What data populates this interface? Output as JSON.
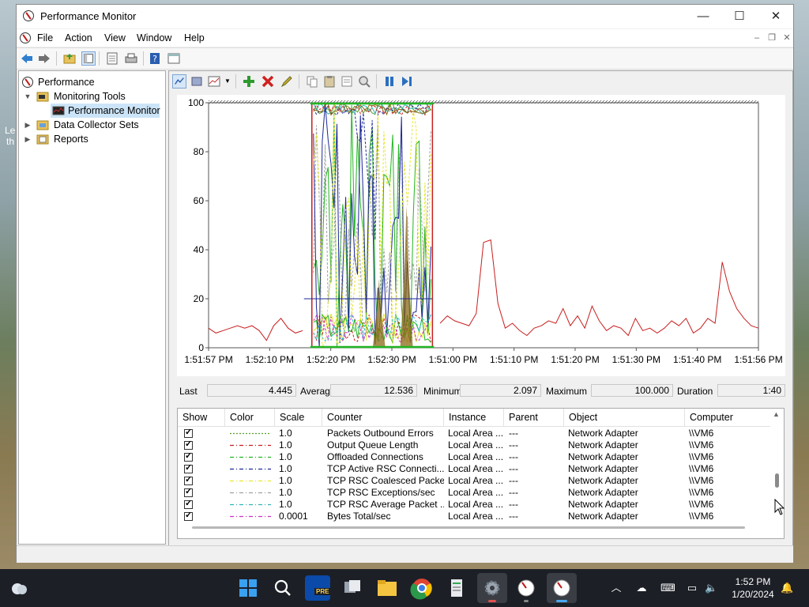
{
  "window": {
    "title": "Performance Monitor",
    "controls": {
      "minimize": "—",
      "maximize": "☐",
      "close": "✕"
    }
  },
  "menu": [
    "File",
    "Action",
    "View",
    "Window",
    "Help"
  ],
  "tree": {
    "root": "Performance",
    "items": [
      {
        "label": "Monitoring Tools",
        "expanded": true
      },
      {
        "label": "Performance Monitor",
        "selected": true
      },
      {
        "label": "Data Collector Sets",
        "expanded": false
      },
      {
        "label": "Reports",
        "expanded": false
      }
    ]
  },
  "chart_data": {
    "type": "line",
    "y_ticks": [
      "100",
      "80",
      "60",
      "40",
      "20",
      "0"
    ],
    "ylim": [
      0,
      100
    ],
    "x_ticks": [
      "1:51:57 PM",
      "1:52:10 PM",
      "1:52:20 PM",
      "1:52:30 PM",
      "1:51:00 PM",
      "1:51:10 PM",
      "1:51:20 PM",
      "1:51:30 PM",
      "1:51:40 PM",
      "1:51:56 PM"
    ],
    "series": [
      {
        "color": "#c81e1e",
        "values": [
          8,
          6,
          7,
          8,
          9,
          8,
          9,
          7,
          3,
          9,
          12,
          8,
          6,
          7,
          8,
          7,
          10,
          14,
          19,
          22,
          29,
          38,
          34,
          29,
          24,
          32,
          23,
          18,
          24,
          15,
          19,
          13,
          10,
          13,
          11,
          10,
          9,
          14,
          43,
          44,
          18,
          8,
          10,
          7,
          5,
          8,
          9,
          11,
          10,
          16,
          9,
          13,
          8,
          17,
          11,
          7,
          9,
          8,
          5,
          12,
          7,
          8,
          6,
          8,
          11,
          9,
          12,
          6,
          8,
          12,
          10,
          35,
          23,
          16,
          12,
          9,
          8
        ]
      }
    ],
    "selected_window_color": "#c81e1e"
  },
  "stats": {
    "last_label": "Last",
    "last_value": "4.445",
    "average_label": "Average",
    "average_value": "12.536",
    "minimum_label": "Minimum",
    "minimum_value": "2.097",
    "maximum_label": "Maximum",
    "maximum_value": "100.000",
    "duration_label": "Duration",
    "duration_value": "1:40"
  },
  "legend": {
    "columns": [
      "Show",
      "Color",
      "Scale",
      "Counter",
      "Instance",
      "Parent",
      "Object",
      "Computer"
    ],
    "rows": [
      {
        "color": "#5aa02c",
        "style": "dotted",
        "scale": "1.0",
        "counter": "Packets Outbound Errors",
        "instance": "Local Area ...",
        "parent": "---",
        "object": "Network Adapter",
        "computer": "\\\\VM6"
      },
      {
        "color": "#c81e1e",
        "style": "dashdot",
        "scale": "1.0",
        "counter": "Output Queue Length",
        "instance": "Local Area ...",
        "parent": "---",
        "object": "Network Adapter",
        "computer": "\\\\VM6"
      },
      {
        "color": "#22b422",
        "style": "dashdot",
        "scale": "1.0",
        "counter": "Offloaded Connections",
        "instance": "Local Area ...",
        "parent": "---",
        "object": "Network Adapter",
        "computer": "\\\\VM6"
      },
      {
        "color": "#1e2896",
        "style": "dashdot",
        "scale": "1.0",
        "counter": "TCP Active RSC Connecti...",
        "instance": "Local Area ...",
        "parent": "---",
        "object": "Network Adapter",
        "computer": "\\\\VM6"
      },
      {
        "color": "#e6e632",
        "style": "dashdot",
        "scale": "1.0",
        "counter": "TCP RSC Coalesced Packe...",
        "instance": "Local Area ...",
        "parent": "---",
        "object": "Network Adapter",
        "computer": "\\\\VM6"
      },
      {
        "color": "#a0a0a0",
        "style": "dashdot",
        "scale": "1.0",
        "counter": "TCP RSC Exceptions/sec",
        "instance": "Local Area ...",
        "parent": "---",
        "object": "Network Adapter",
        "computer": "\\\\VM6"
      },
      {
        "color": "#32b4b4",
        "style": "dashdot",
        "scale": "1.0",
        "counter": "TCP RSC Average Packet ...",
        "instance": "Local Area ...",
        "parent": "---",
        "object": "Network Adapter",
        "computer": "\\\\VM6"
      },
      {
        "color": "#c832c8",
        "style": "dashdot",
        "scale": "0.0001",
        "counter": "Bytes Total/sec",
        "instance": "Local Area ...",
        "parent": "---",
        "object": "Network Adapter",
        "computer": "\\\\VM6"
      }
    ]
  },
  "taskbar": {
    "time": "1:52 PM",
    "date": "1/20/2024",
    "pre_badge": "PRE",
    "apps": [
      "start-button",
      "search-button",
      "dev-tools-app",
      "task-view",
      "file-explorer",
      "chrome",
      "notepad-app",
      "settings-app",
      "perfmon-app-1",
      "perfmon-app-2"
    ]
  }
}
